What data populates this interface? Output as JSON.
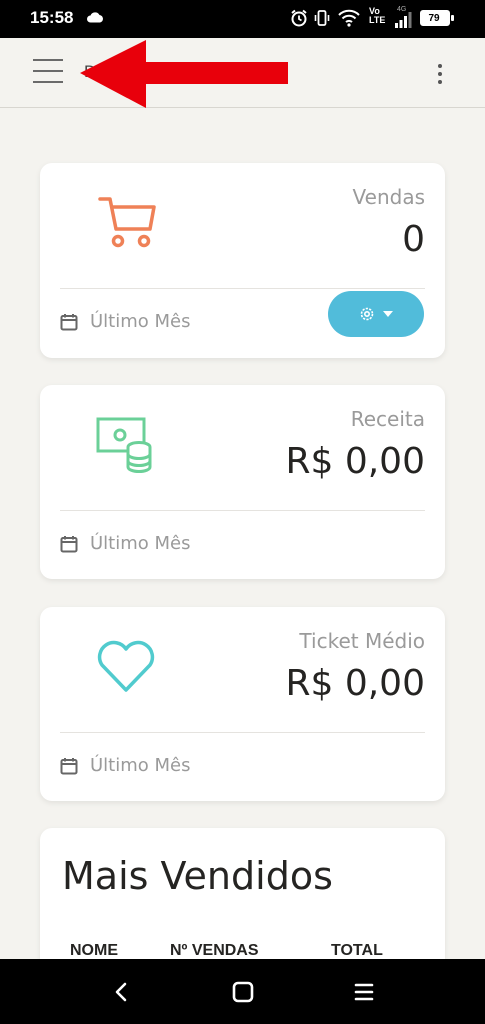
{
  "status_bar": {
    "time": "15:58",
    "network_top": "Vo",
    "network_bottom": "LTE",
    "signal_type": "4G",
    "battery": "79"
  },
  "header": {
    "title": "D            O"
  },
  "cards": [
    {
      "label": "Vendas",
      "value": "0",
      "footer": "Último Mês",
      "icon": "shopping-cart-icon",
      "color": "#ef8157"
    },
    {
      "label": "Receita",
      "value": "R$ 0,00",
      "footer": "Último Mês",
      "icon": "money-coins-icon",
      "color": "#6bd098"
    },
    {
      "label": "Ticket Médio",
      "value": "R$ 0,00",
      "footer": "Último Mês",
      "icon": "heart-icon",
      "color": "#51cbce"
    }
  ],
  "top_sellers": {
    "title": "Mais Vendidos",
    "columns": [
      "NOME",
      "Nº VENDAS",
      "TOTAL"
    ]
  },
  "accent_colors": {
    "settings_button": "#51bcda",
    "arrow": "#e8000b"
  }
}
